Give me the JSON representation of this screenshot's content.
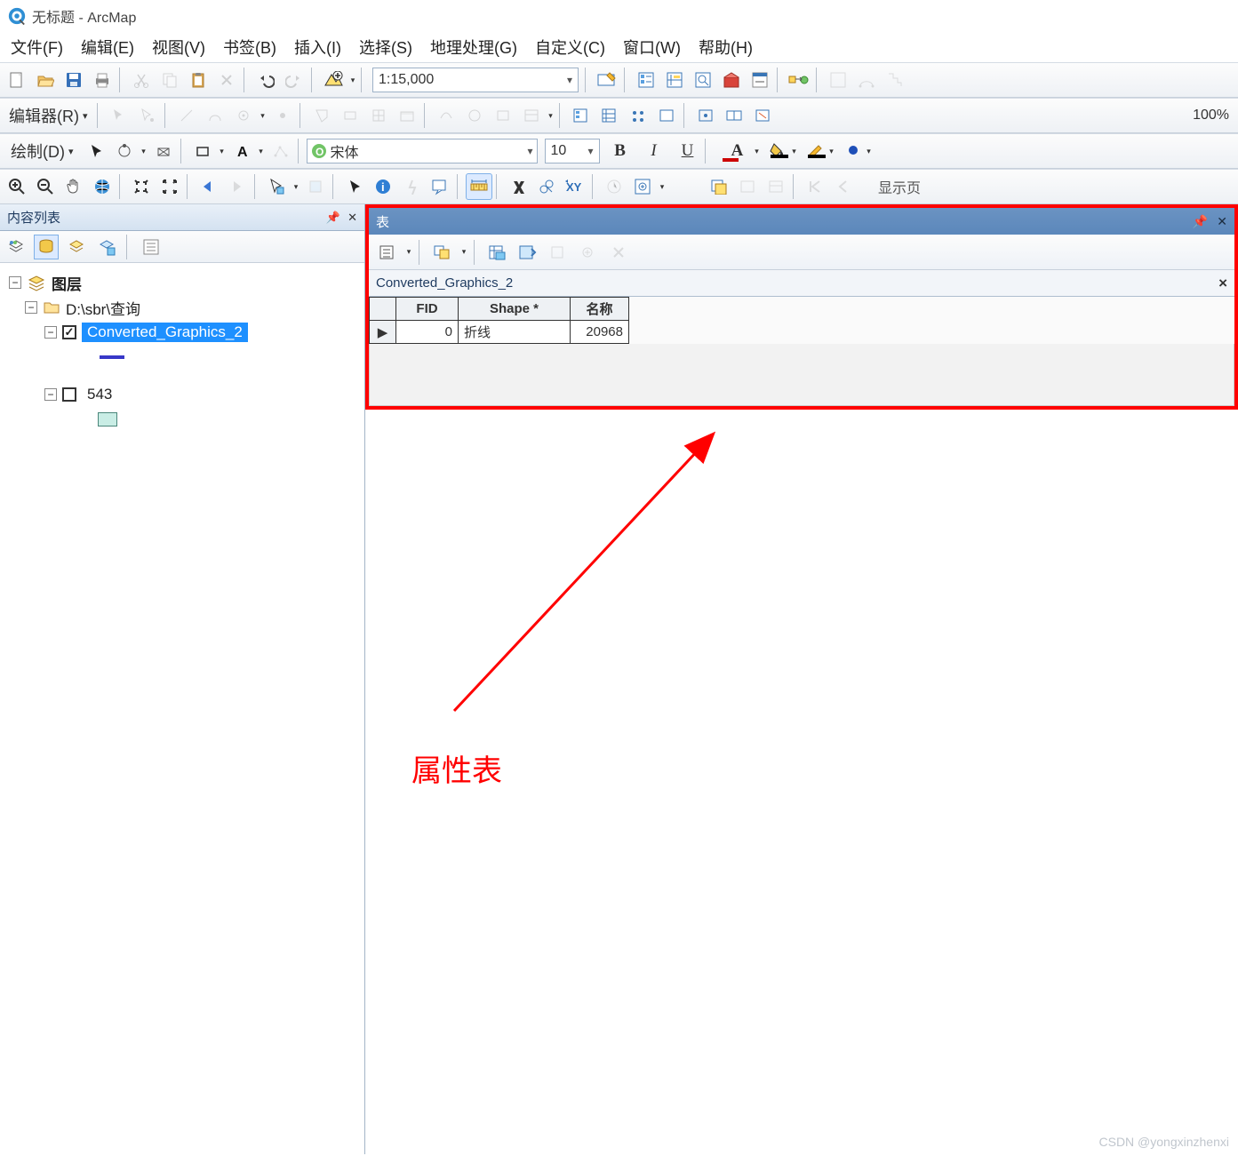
{
  "window": {
    "title": "无标题 - ArcMap"
  },
  "menu": {
    "file": "文件(F)",
    "edit": "编辑(E)",
    "view": "视图(V)",
    "bookmark": "书签(B)",
    "insert": "插入(I)",
    "select": "选择(S)",
    "geoproc": "地理处理(G)",
    "customize": "自定义(C)",
    "window": "窗口(W)",
    "help": "帮助(H)"
  },
  "toolbar1": {
    "scale": "1:15,000"
  },
  "editor": {
    "label": "编辑器(R)"
  },
  "draw": {
    "label": "绘制(D)",
    "font": "宋体",
    "size": "10"
  },
  "format": {
    "bold": "B",
    "italic": "I",
    "underline": "U",
    "fontcolor": "A"
  },
  "zoom_pct": "100%",
  "nav_toolbar": {
    "show": "显示页"
  },
  "toc": {
    "title": "内容列表",
    "root": "图层",
    "group": "D:\\sbr\\查询",
    "layer1": "Converted_Graphics_2",
    "layer2": "543"
  },
  "table": {
    "title": "表",
    "tab": "Converted_Graphics_2",
    "columns": {
      "fid": "FID",
      "shape": "Shape *",
      "name": "名称"
    },
    "rows": [
      {
        "fid": "0",
        "shape": "折线",
        "name": "20968"
      }
    ]
  },
  "annotation": {
    "label": "属性表"
  },
  "watermark": "CSDN @yongxinzhenxi"
}
